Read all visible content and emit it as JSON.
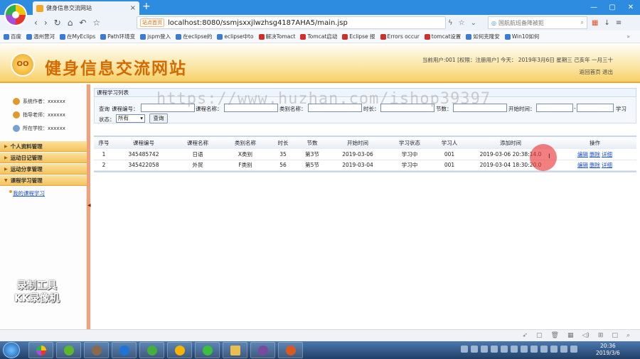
{
  "browser": {
    "tab_title": "健身信息交流网站",
    "new_tab": "+",
    "site_warning": "站点首页",
    "url": "localhost:8080/ssmjsxxjlwzhsg4187AHA5/main.jsp",
    "search_placeholder": "国航航班备降被拒",
    "window_controls": [
      "—",
      "▢",
      "✕"
    ],
    "bookmarks": [
      "百度",
      "温州营河",
      "在MyEclips",
      "Path环境变",
      "jspm登入",
      "在eclipse的",
      "eclipse中to",
      "解决Tomact",
      "Tomcat启动",
      "Eclipse 报",
      "Errors occur",
      "tomcat设置",
      "如何克隆安",
      "Win10如何"
    ],
    "bookmarks_more": "»"
  },
  "header": {
    "logo_text": "OO",
    "title": "健身信息交流网站",
    "user_info": "当前用户:001 [权限：注册用户] 今天： 2019年3月6日 星期三 己亥年 一月三十",
    "link_home": "返回首页",
    "link_logout": "退出"
  },
  "sidebar": {
    "info": [
      {
        "label": "系统作者：xxxxxx"
      },
      {
        "label": "指导老师：xxxxxx"
      },
      {
        "label": "所在学校：xxxxxx"
      }
    ],
    "menus": [
      "个人资料管理",
      "运动日记管理",
      "运动分享管理",
      "课程学习管理"
    ],
    "submenu_item": "我的课程学习",
    "toggle_arrow": "◀"
  },
  "panel": {
    "title": "课程学习列表",
    "form": {
      "query_prefix": "查询",
      "course_no": "课程编号：",
      "course_name": "课程名称：",
      "category_name": "类别名称：",
      "duration": "时长：",
      "sections": "节数：",
      "start_time": "开始时间：",
      "start_sep": "-",
      "study_status_tail": "学习",
      "status": "状态：",
      "status_value": "所有",
      "query_button": "查询"
    },
    "table": {
      "headers": [
        "序号",
        "课程编号",
        "课程名称",
        "类别名称",
        "时长",
        "节数",
        "开始时间",
        "学习状态",
        "学习人",
        "添加时间",
        "操作"
      ],
      "rows": [
        {
          "cells": [
            "1",
            "345485742",
            "日语",
            "X类别",
            "35",
            "第3节",
            "2019-03-06",
            "学习中",
            "001",
            "2019-03-06 20:38:14.0"
          ]
        },
        {
          "cells": [
            "2",
            "345422058",
            "外贸",
            "F类别",
            "56",
            "第5节",
            "2019-03-04",
            "学习中",
            "001",
            "2019-03-04 18:30:20.0"
          ]
        }
      ],
      "actions": [
        "编辑",
        "删除",
        "详细"
      ]
    }
  },
  "overlay": {
    "watermark_url": "https://www.huzhan.com/ishop39397",
    "watermark_tool_1": "录制工具",
    "watermark_tool_2": "KK录像机",
    "cursor_glyph": "I"
  },
  "taskbar": {
    "time": "20:36",
    "date": "2019/3/6"
  },
  "colors": {
    "header_title": "#d46b00",
    "tabbar": "#2d8be0",
    "menu_group": "#f4c35c",
    "link": "#1a4fd8"
  }
}
